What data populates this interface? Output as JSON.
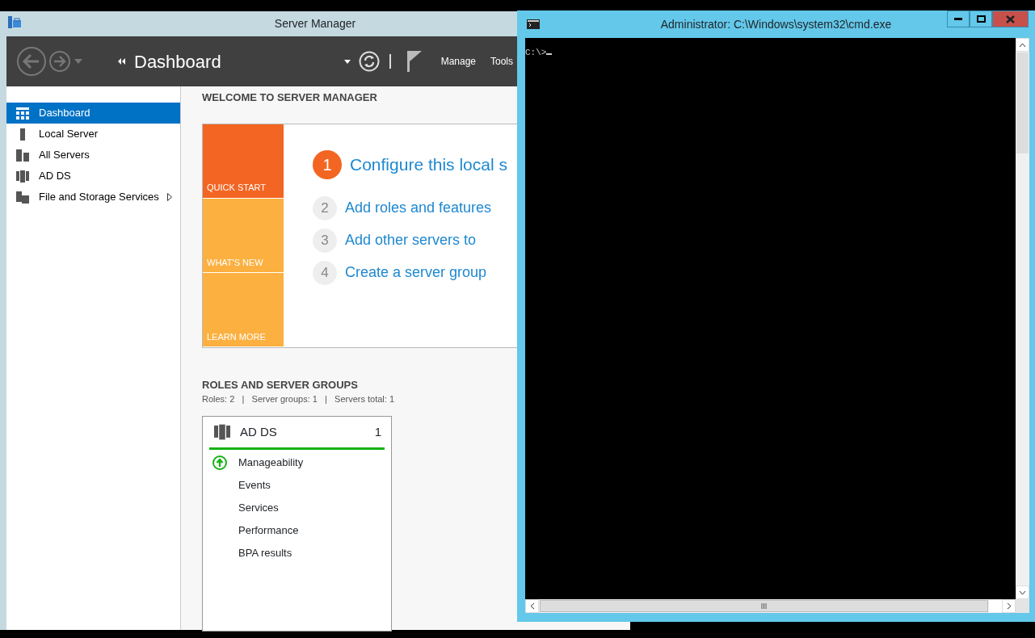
{
  "server_manager": {
    "title": "Server Manager",
    "breadcrumb": "Dashboard",
    "menu": [
      "Manage",
      "Tools"
    ],
    "sidebar": [
      {
        "label": "Dashboard",
        "selected": true,
        "expandable": false
      },
      {
        "label": "Local Server",
        "selected": false,
        "expandable": false
      },
      {
        "label": "All Servers",
        "selected": false,
        "expandable": false
      },
      {
        "label": "AD DS",
        "selected": false,
        "expandable": false
      },
      {
        "label": "File and Storage Services",
        "selected": false,
        "expandable": true
      }
    ],
    "welcome": {
      "heading": "WELCOME TO SERVER MANAGER",
      "tiles": [
        {
          "label": "QUICK START",
          "color": "#f26522"
        },
        {
          "label": "WHAT'S NEW",
          "color": "#fbb040"
        },
        {
          "label": "LEARN MORE",
          "color": "#fbb040"
        }
      ],
      "steps": [
        {
          "number": "1",
          "text": "Configure this local s",
          "active": true
        },
        {
          "number": "2",
          "text": "Add roles and features",
          "active": false
        },
        {
          "number": "3",
          "text": "Add other servers to",
          "active": false
        },
        {
          "number": "4",
          "text": "Create a server group",
          "active": false
        }
      ]
    },
    "roles": {
      "heading": "ROLES AND SERVER GROUPS",
      "summary": "Roles: 2   |   Server groups: 1   |   Servers total: 1",
      "cards": [
        {
          "title": "AD DS",
          "count": "1",
          "color": "#17b217",
          "items": [
            {
              "label": "Manageability",
              "healthy": true
            },
            {
              "label": "Events",
              "healthy": false
            },
            {
              "label": "Services",
              "healthy": false
            },
            {
              "label": "Performance",
              "healthy": false
            },
            {
              "label": "BPA results",
              "healthy": false
            }
          ]
        }
      ]
    }
  },
  "cmd": {
    "title": "Administrator: C:\\Windows\\system32\\cmd.exe",
    "prompt": "C:\\>"
  }
}
